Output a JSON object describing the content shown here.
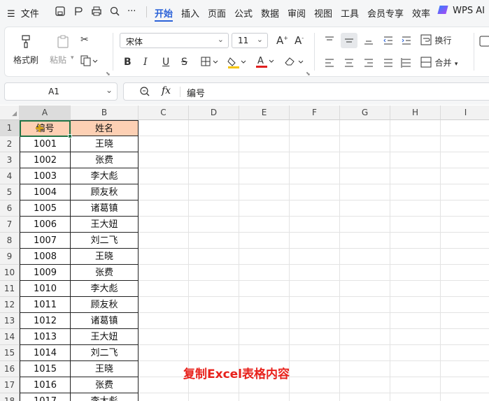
{
  "menubar": {
    "menu_icon": "☰",
    "file": "文件",
    "more": "···",
    "tabs": [
      "开始",
      "插入",
      "页面",
      "公式",
      "数据",
      "审阅",
      "视图",
      "工具",
      "会员专享",
      "效率"
    ],
    "active_tab": 0,
    "wps_ai": "WPS AI"
  },
  "ribbon": {
    "format_painter": "格式刷",
    "paste": "粘贴",
    "font_name": "宋体",
    "font_size": "11",
    "wrap_text": "换行",
    "merge": "合并"
  },
  "formula_bar": {
    "name_box": "A1",
    "fx": "fx",
    "content": "编号"
  },
  "sheet": {
    "columns": [
      "A",
      "B",
      "C",
      "D",
      "E",
      "F",
      "G",
      "H",
      "I"
    ],
    "rows": [
      "1",
      "2",
      "3",
      "4",
      "5",
      "6",
      "7",
      "8",
      "9",
      "10",
      "11",
      "12",
      "13",
      "14",
      "15",
      "16",
      "17",
      "18"
    ],
    "header": [
      "编号",
      "姓名"
    ],
    "data": [
      [
        "1001",
        "王晓"
      ],
      [
        "1002",
        "张费"
      ],
      [
        "1003",
        "李大彪"
      ],
      [
        "1004",
        "顾友秋"
      ],
      [
        "1005",
        "诸葛镇"
      ],
      [
        "1006",
        "王大妞"
      ],
      [
        "1007",
        "刘二飞"
      ],
      [
        "1008",
        "王晓"
      ],
      [
        "1009",
        "张费"
      ],
      [
        "1010",
        "李大彪"
      ],
      [
        "1011",
        "顾友秋"
      ],
      [
        "1012",
        "诸葛镇"
      ],
      [
        "1013",
        "王大妞"
      ],
      [
        "1014",
        "刘二飞"
      ],
      [
        "1015",
        "王晓"
      ],
      [
        "1016",
        "张费"
      ],
      [
        "1017",
        "李大彪"
      ]
    ]
  },
  "caption": "复制Excel表格内容",
  "colors": {
    "accent": "#2b62d8",
    "header_fill": "#fdd0b4",
    "selection": "#217346",
    "caption": "#e8221c"
  }
}
